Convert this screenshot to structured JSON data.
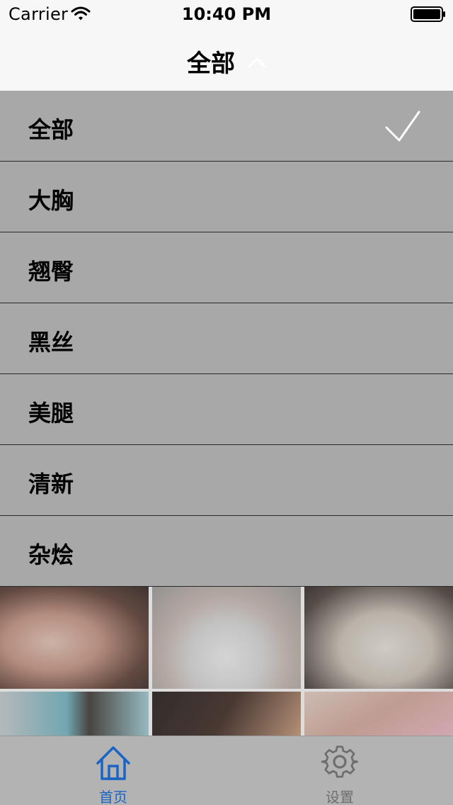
{
  "status_bar": {
    "carrier": "Carrier",
    "time": "10:40 PM",
    "wifi_icon": "wifi-icon",
    "battery_icon": "battery-full-icon"
  },
  "nav": {
    "title": "全部",
    "toggle_icon": "chevron-up-icon"
  },
  "categories": [
    {
      "label": "全部",
      "selected": true
    },
    {
      "label": "大胸",
      "selected": false
    },
    {
      "label": "翘臀",
      "selected": false
    },
    {
      "label": "黑丝",
      "selected": false
    },
    {
      "label": "美腿",
      "selected": false
    },
    {
      "label": "清新",
      "selected": false
    },
    {
      "label": "杂烩",
      "selected": false
    }
  ],
  "tab_bar": {
    "tabs": [
      {
        "label": "首页",
        "icon": "home-icon",
        "active": true
      },
      {
        "label": "设置",
        "icon": "gear-icon",
        "active": false
      }
    ]
  },
  "colors": {
    "nav_background": "#f7f7f7",
    "list_background": "#a8a8a8",
    "tab_active": "#1a64c4",
    "tab_inactive": "#6e6e6e"
  }
}
